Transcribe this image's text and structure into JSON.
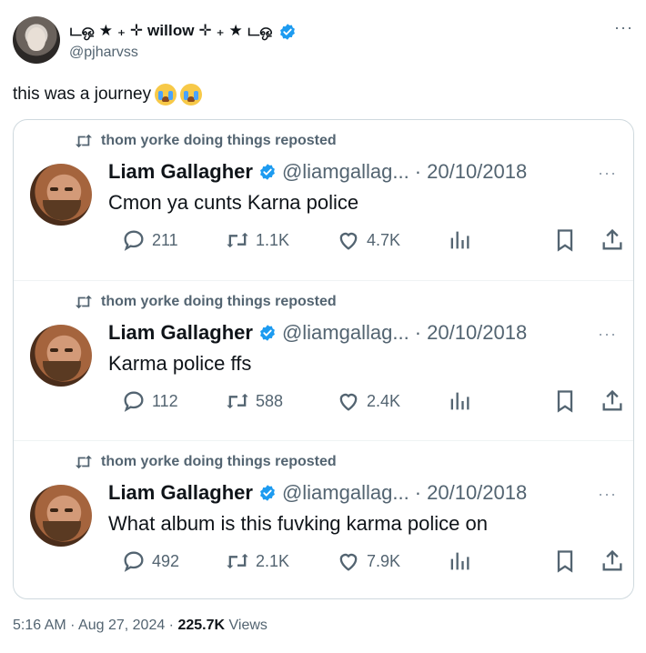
{
  "author": {
    "name": "டஒ ★ ₊ ✛ willow ✛ ₊ ★ டஒ",
    "handle": "@pjharvss",
    "more_label": "···",
    "avatar_icon": "profile-photo"
  },
  "post": {
    "text": "this was a journey",
    "emojis": [
      "loudly-crying-face",
      "loudly-crying-face"
    ]
  },
  "quoted_items": [
    {
      "repost_by": "thom yorke doing things reposted",
      "name": "Liam Gallagher",
      "handle": "@liamgallag...",
      "date": "· 20/10/2018",
      "text": "Cmon ya cunts Karna police",
      "replies": "211",
      "reposts": "1.1K",
      "likes": "4.7K"
    },
    {
      "repost_by": "thom yorke doing things reposted",
      "name": "Liam Gallagher",
      "handle": "@liamgallag...",
      "date": "· 20/10/2018",
      "text": "Karma police ffs",
      "replies": "112",
      "reposts": "588",
      "likes": "2.4K"
    },
    {
      "repost_by": "thom yorke doing things reposted",
      "name": "Liam Gallagher",
      "handle": "@liamgallag...",
      "date": "· 20/10/2018",
      "text": "What album is this fuvking karma police on",
      "replies": "492",
      "reposts": "2.1K",
      "likes": "7.9K"
    }
  ],
  "footer": {
    "time": "5:16 AM · Aug 27, 2024 ·",
    "views_count": "225.7K",
    "views_label": "Views"
  },
  "colors": {
    "verified": "#1d9bf0",
    "muted_text": "#536471",
    "border": "#cfd9de"
  }
}
